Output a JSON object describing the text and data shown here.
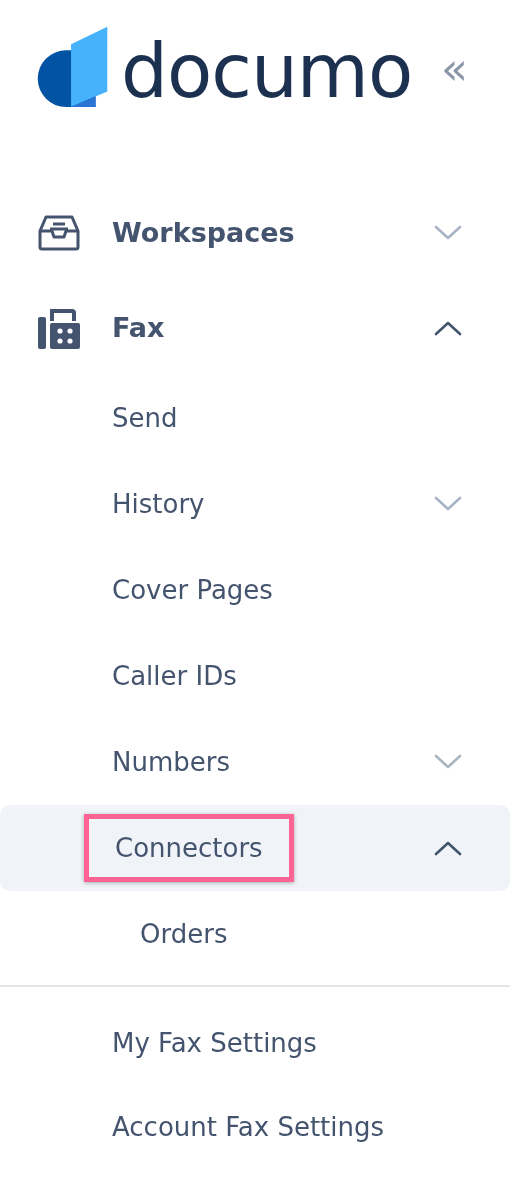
{
  "logo": {
    "wordmark": "documo"
  },
  "collapse_button": {
    "label": "«"
  },
  "nav": [
    {
      "label": "Workspaces",
      "expanded": false
    },
    {
      "label": "Fax",
      "expanded": true,
      "children": [
        {
          "label": "Send",
          "selected": false
        },
        {
          "label": "History",
          "expanded": false,
          "selected": false
        },
        {
          "label": "Cover Pages",
          "selected": false
        },
        {
          "label": "Caller IDs",
          "selected": false
        },
        {
          "label": "Numbers",
          "expanded": false,
          "selected": false
        },
        {
          "label": "Connectors",
          "expanded": true,
          "selected": true,
          "annotated": true,
          "children": [
            {
              "label": "Orders",
              "selected": false
            }
          ]
        }
      ]
    }
  ],
  "settings": [
    {
      "label": "My Fax Settings"
    },
    {
      "label": "Account Fax Settings"
    }
  ]
}
